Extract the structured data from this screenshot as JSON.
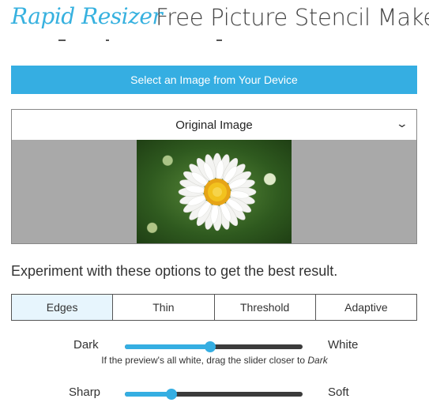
{
  "header": {
    "logo_text": "Rapid Resizer",
    "title": "Free Picture Stencil Maker"
  },
  "select_button": "Select an Image from Your Device",
  "view_dropdown": {
    "selected": "Original Image"
  },
  "instruction": "Experiment with these options to get the best result.",
  "tabs": [
    "Edges",
    "Thin",
    "Threshold",
    "Adaptive"
  ],
  "active_tab": "Edges",
  "sliders": {
    "darkness": {
      "left_label": "Dark",
      "right_label": "White",
      "value": 0.48
    },
    "sharpness": {
      "left_label": "Sharp",
      "right_label": "Soft",
      "value": 0.26
    }
  },
  "hint": {
    "text": "If the preview's all white, drag the slider closer to ",
    "emphasis": "Dark"
  },
  "colors": {
    "accent": "#35aee2",
    "preview_bg": "#a9a9a9",
    "active_tab_bg": "#e7f5fd"
  }
}
